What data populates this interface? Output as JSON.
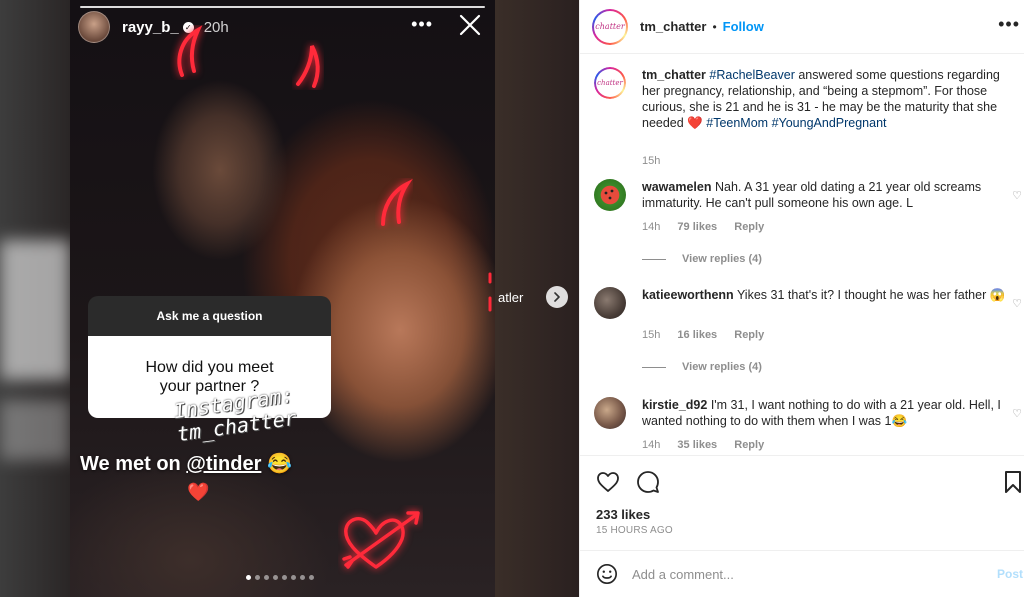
{
  "story": {
    "username": "rayy_b_",
    "time": "20h",
    "question_header": "Ask me a question",
    "question_text": "How did you meet your partner ?",
    "watermark_line1": "Instagram:",
    "watermark_line2": "tm_chatter",
    "caption_prefix": "We met on ",
    "caption_mention": "@tinder",
    "caption_emoji": "😂",
    "heart_emoji": "❤️",
    "progress_segments": 1,
    "carousel_dots": 8,
    "carousel_active_index": 0
  },
  "peek_text": "atler",
  "post": {
    "author": "tm_chatter",
    "follow_label": "Follow",
    "separator": "•",
    "avatar_text": "chatter",
    "caption": {
      "username": "tm_chatter",
      "tag1": "#RachelBeaver",
      "text1": " answered some questions regarding her pregnancy, relationship, and “being a stepmom”. For those curious, she is 21 and he is 31 - he may be the maturity that she needed ",
      "heart": "❤️",
      "tag2": "#TeenMom",
      "tag3": "#YoungAndPregnant",
      "time": "15h"
    },
    "comments": [
      {
        "username": "wawamelen",
        "text": "Nah. A 31 year old dating a 21 year old screams immaturity. He can't pull someone his own age. L",
        "time": "14h",
        "likes": "79 likes",
        "reply": "Reply",
        "view_replies": "View replies (4)"
      },
      {
        "username": "katieeworthenn",
        "text": "Yikes 31 that's it? I thought he was her father 😱",
        "time": "15h",
        "likes": "16 likes",
        "reply": "Reply",
        "view_replies": "View replies (4)"
      },
      {
        "username": "kirstie_d92",
        "text": "I'm 31, I want nothing to do with a 21 year old. Hell, I wanted nothing to do with them when I was 1😂",
        "time": "14h",
        "likes": "35 likes",
        "reply": "Reply"
      }
    ],
    "likes": "233 likes",
    "posted_ago": "15 HOURS AGO",
    "add_comment_placeholder": "Add a comment...",
    "post_label": "Post"
  },
  "colors": {
    "link_blue": "#0095f6",
    "hashtag": "#00376b",
    "neon_red": "#ff2a3a",
    "muted": "#8e8e8e"
  }
}
